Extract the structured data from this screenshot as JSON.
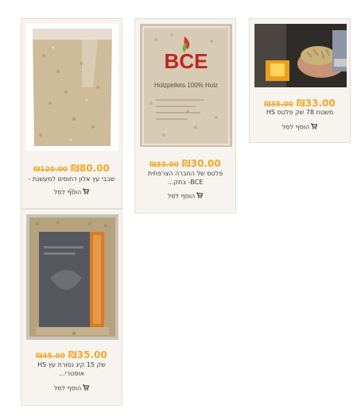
{
  "currency": "₪",
  "add_to_cart_label": "הוסף לסל",
  "products": [
    {
      "old_price": "35.00",
      "new_price": "33.00",
      "title": "משטח 78 שק פלטס HS"
    },
    {
      "old_price": "33.00",
      "new_price": "30.00",
      "title": "פלטס של החברה הצרפתית BCE- בתק...",
      "bag_brand": "BCE",
      "bag_text": "Holzpellets 100% Holz"
    },
    {
      "old_price": "120.00",
      "new_price": "80.00",
      "title": "שבבי עץ אלון דחוסים למעשנת - ..."
    },
    {
      "old_price": "45.00",
      "new_price": "35.00",
      "title": "שק 15 קיג נסורת עץ HS אוסטרי..."
    }
  ],
  "colors": {
    "price": "#f0a92a",
    "card_bg": "#f7f3ef",
    "card_border": "#e6ddd5",
    "text": "#3a3a3a"
  }
}
